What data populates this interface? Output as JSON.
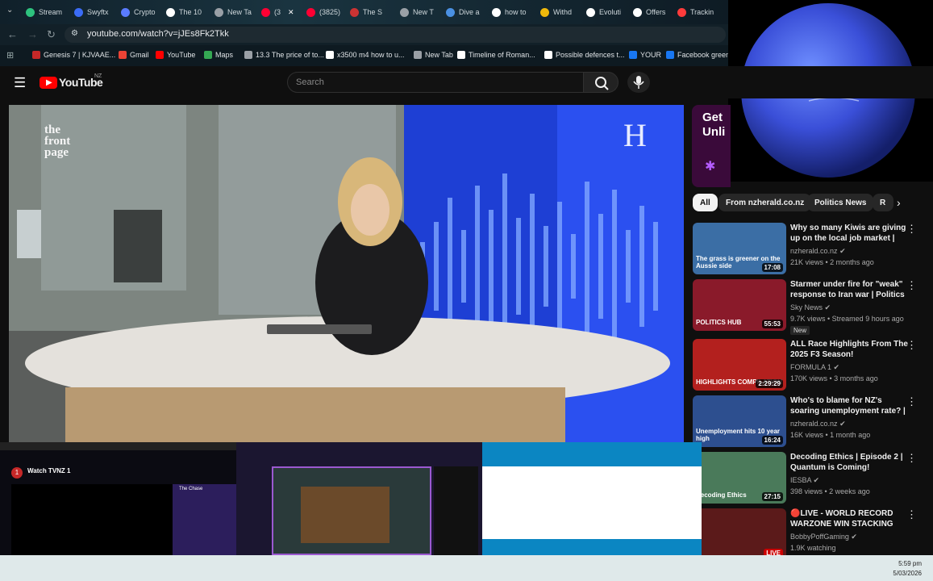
{
  "tabs": [
    {
      "label": "Stream",
      "color": "#2ec27e"
    },
    {
      "label": "Swyftx",
      "color": "#3b6cf6"
    },
    {
      "label": "Crypto",
      "color": "#5a7bff"
    },
    {
      "label": "The 10",
      "color": "#ffffff"
    },
    {
      "label": "New Ta",
      "color": "#9aa0a6"
    },
    {
      "label": "(3",
      "color": "#ff0033",
      "close": "✕"
    },
    {
      "label": "(3825)",
      "color": "#ff0033"
    },
    {
      "label": "The S",
      "color": "#c33"
    },
    {
      "label": "New T",
      "color": "#9aa0a6"
    },
    {
      "label": "Dive a",
      "color": "#4a90e2"
    },
    {
      "label": "how to",
      "color": "#ffffff"
    },
    {
      "label": "Withd",
      "color": "#f0b90b"
    },
    {
      "label": "Evoluti",
      "color": "#ffffff"
    },
    {
      "label": "Offers",
      "color": "#ffffff"
    },
    {
      "label": "Trackin",
      "color": "#ff3b3b"
    }
  ],
  "address": {
    "url": "youtube.com/watch?v=jJEs8Fk2Tkk"
  },
  "bookmarks": [
    {
      "label": "Genesis 7 | KJVAAE...",
      "color": "#c62828"
    },
    {
      "label": "Gmail",
      "color": "#ea4335"
    },
    {
      "label": "YouTube",
      "color": "#ff0000"
    },
    {
      "label": "Maps",
      "color": "#34a853"
    },
    {
      "label": "13.3 The price of to...",
      "color": "#9aa0a6"
    },
    {
      "label": "x3500 m4 how to u...",
      "color": "#ffffff"
    },
    {
      "label": "New Tab",
      "color": "#9aa0a6"
    },
    {
      "label": "Timeline of Roman...",
      "color": "#ffffff"
    },
    {
      "label": "Possible defences t...",
      "color": "#ffffff"
    },
    {
      "label": "YOUR",
      "color": "#1877f2"
    },
    {
      "label": "Facebook green",
      "color": "#1877f2"
    }
  ],
  "youtube": {
    "logo_text": "YouTube",
    "region": "NZ",
    "search_placeholder": "Search"
  },
  "video": {
    "wall_text": "the front page",
    "logo_letter": "H"
  },
  "ad": {
    "line1": "Get",
    "line2": "Unli"
  },
  "chips": [
    "All",
    "From nzherald.co.nz",
    "Politics News",
    "R"
  ],
  "recommendations": [
    {
      "title": "Why so many Kiwis are giving up on the local job market | Th...",
      "channel": "nzherald.co.nz",
      "meta": "21K views • 2 months ago",
      "duration": "17:08",
      "overlay": "The grass is greener on the Aussie side",
      "bg": "#3b6ea5"
    },
    {
      "title": "Starmer under fire for \"weak\" response to Iran war | Politics ...",
      "channel": "Sky News",
      "meta": "9.7K views • Streamed 9 hours ago",
      "duration": "55:53",
      "overlay": "POLITICS HUB",
      "badge": "New",
      "bg": "#8a1a2a"
    },
    {
      "title": "ALL Race Highlights From The 2025 F3 Season!",
      "channel": "FORMULA 1",
      "meta": "170K views • 3 months ago",
      "duration": "2:29:29",
      "overlay": "HIGHLIGHTS COMPILATION",
      "bg": "#b3201e"
    },
    {
      "title": "Who's to blame for NZ's soaring unemployment rate? | The Fro...",
      "channel": "nzherald.co.nz",
      "meta": "16K views • 1 month ago",
      "duration": "16:24",
      "overlay": "Unemployment hits 10 year high",
      "bg": "#2d4f8f"
    },
    {
      "title": "Decoding Ethics | Episode 2 | Quantum is Coming!",
      "channel": "IESBA",
      "meta": "398 views • 2 weeks ago",
      "duration": "27:15",
      "overlay": "Decoding Ethics",
      "bg": "#4a7a5a"
    },
    {
      "title": "🔴LIVE - WORLD RECORD WARZONE WIN STACKING",
      "channel": "BobbyPoffGaming",
      "meta": "1.9K watching",
      "duration": "LIVE",
      "overlay": "",
      "bg": "#5b1a1a"
    }
  ],
  "previews": {
    "p1_title": "Watch TVNZ 1",
    "p1_side": "The Chase"
  },
  "clock": {
    "time": "5:59 pm",
    "date": "5/03/2026"
  }
}
